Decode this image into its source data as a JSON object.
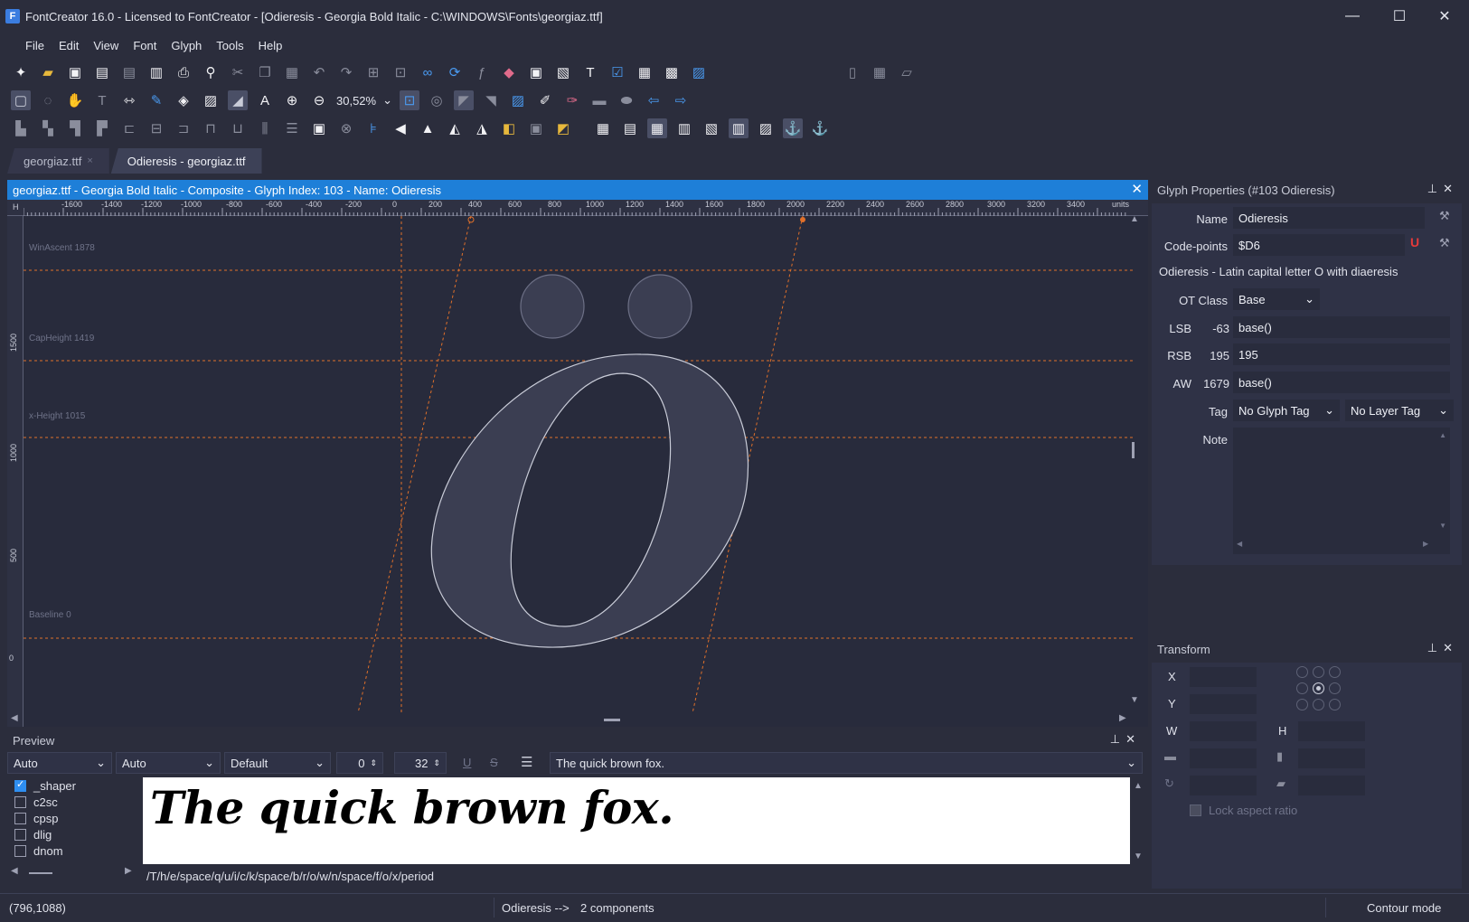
{
  "window": {
    "title": "FontCreator 16.0 - Licensed to FontCreator - [Odieresis - Georgia Bold Italic - C:\\WINDOWS\\Fonts\\georgiaz.ttf]",
    "minimize": "—",
    "maximize": "☐",
    "close": "✕"
  },
  "menu": [
    "File",
    "Edit",
    "View",
    "Font",
    "Glyph",
    "Tools",
    "Help"
  ],
  "toolbar": {
    "zoom": "30,52%"
  },
  "tabs": [
    {
      "label": "georgiaz.ttf",
      "close": "×"
    },
    {
      "label": "Odieresis - georgiaz.ttf"
    }
  ],
  "editor": {
    "header": "georgiaz.ttf - Georgia Bold Italic - Composite - Glyph Index: 103 - Name: Odieresis",
    "close": "✕",
    "ruler_corner": "H",
    "ruler_units": "units",
    "ruler_ticks": [
      "-1600",
      "-1400",
      "-1200",
      "-1000",
      "-800",
      "-600",
      "-400",
      "-200",
      "0",
      "200",
      "400",
      "600",
      "800",
      "1000",
      "1200",
      "1400",
      "1600",
      "1800",
      "2000",
      "2200",
      "2400",
      "2600",
      "2800",
      "3000",
      "3200",
      "3400"
    ],
    "vruler_ticks": [
      "1500",
      "1000",
      "500",
      "0"
    ],
    "guides": {
      "win_ascent": "WinAscent 1878",
      "cap_height": "CapHeight 1419",
      "x_height": "x-Height 1015",
      "baseline": "Baseline 0"
    }
  },
  "preview": {
    "title": "Preview",
    "script": "Auto",
    "language": "Auto",
    "direction": "Default",
    "spacing": "0",
    "size": "32",
    "text_input": "The quick brown fox.",
    "rendered": "The quick brown fox.",
    "features": [
      {
        "name": "_shaper",
        "checked": true
      },
      {
        "name": "c2sc",
        "checked": false
      },
      {
        "name": "cpsp",
        "checked": false
      },
      {
        "name": "dlig",
        "checked": false
      },
      {
        "name": "dnom",
        "checked": false
      }
    ],
    "glyph_string": "/T/h/e/space/q/u/i/c/k/space/b/r/o/w/n/space/f/o/x/period"
  },
  "properties": {
    "title": "Glyph Properties (#103 Odieresis)",
    "name_label": "Name",
    "name_value": "Odieresis",
    "codepoints_label": "Code-points",
    "codepoints_value": "$D6",
    "description": "Odieresis - Latin capital letter O with diaeresis",
    "otclass_label": "OT Class",
    "otclass_value": "Base",
    "lsb_label": "LSB",
    "lsb_value": "-63",
    "lsb_expr": "base()",
    "rsb_label": "RSB",
    "rsb_value": "195",
    "rsb_expr": "195",
    "aw_label": "AW",
    "aw_value": "1679",
    "aw_expr": "base()",
    "tag_label": "Tag",
    "glyph_tag": "No Glyph Tag",
    "layer_tag": "No Layer Tag",
    "note_label": "Note"
  },
  "transform": {
    "title": "Transform",
    "x_label": "X",
    "y_label": "Y",
    "w_label": "W",
    "h_label": "H",
    "lock_label": "Lock aspect ratio"
  },
  "status": {
    "coords": "(796,1088)",
    "info": "Odieresis -->",
    "components": "2 components",
    "mode": "Contour mode"
  },
  "colors": {
    "accent": "#1e7fd8",
    "guide": "#e0702a",
    "background": "#2b2d3c"
  }
}
